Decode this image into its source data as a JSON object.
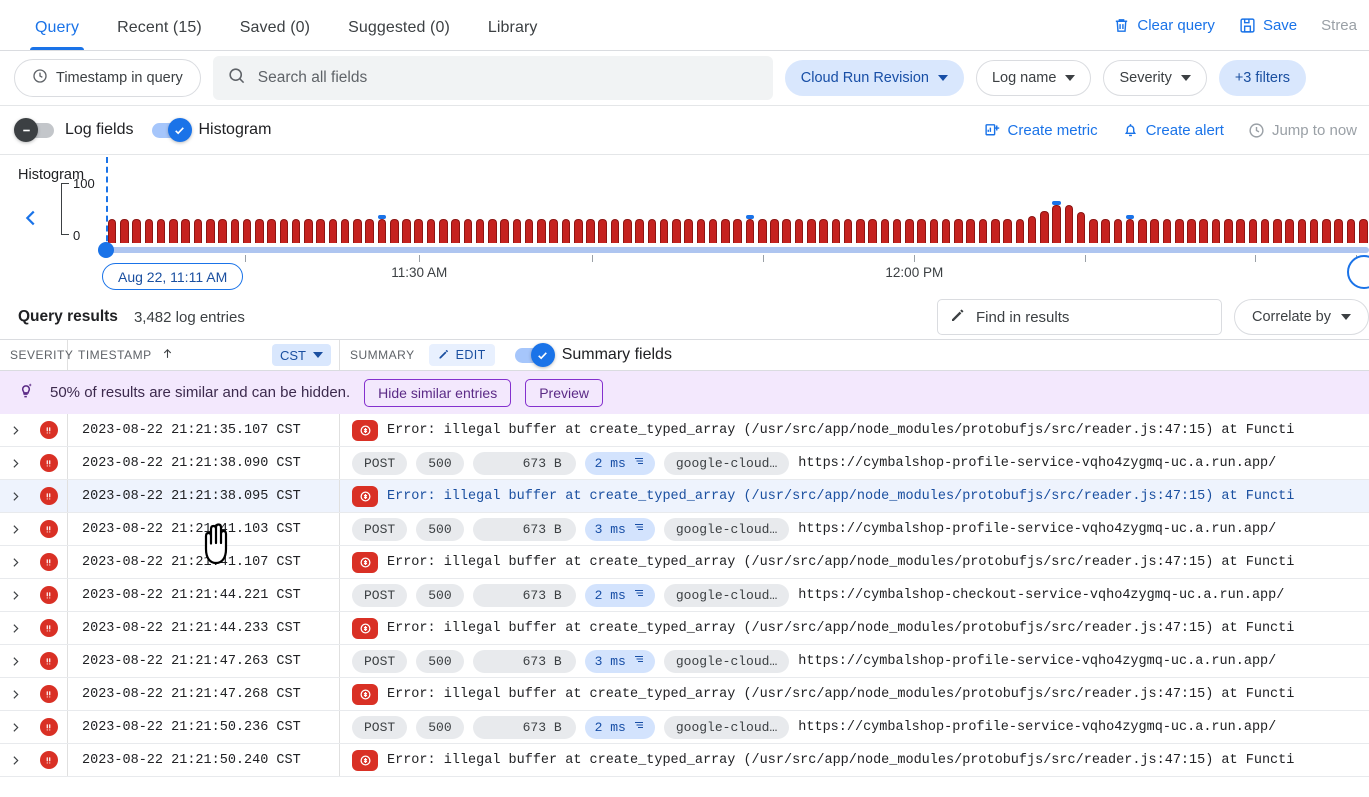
{
  "tabs": [
    {
      "label": "Query",
      "active": true
    },
    {
      "label": "Recent (15)",
      "active": false
    },
    {
      "label": "Saved (0)",
      "active": false
    },
    {
      "label": "Suggested (0)",
      "active": false
    },
    {
      "label": "Library",
      "active": false
    }
  ],
  "top_actions": [
    {
      "label": "Clear query",
      "icon": "trash-icon",
      "disabled": false
    },
    {
      "label": "Save",
      "icon": "save-icon",
      "disabled": false
    },
    {
      "label": "Strea",
      "icon": "none",
      "disabled": true
    }
  ],
  "filters": {
    "timestamp_chip": "Timestamp in query",
    "search_placeholder": "Search all fields",
    "search_value": "",
    "chips": [
      {
        "label": "Cloud Run Revision",
        "selected": true
      },
      {
        "label": "Log name",
        "selected": false
      },
      {
        "label": "Severity",
        "selected": false
      }
    ],
    "more_filters": "+3 filters"
  },
  "toggles": {
    "log_fields": {
      "label": "Log fields",
      "on": false
    },
    "histogram": {
      "label": "Histogram",
      "on": true
    }
  },
  "toolbar_actions": [
    {
      "label": "Create metric",
      "icon": "chart-plus-icon",
      "disabled": false
    },
    {
      "label": "Create alert",
      "icon": "bell-plus-icon",
      "disabled": false
    },
    {
      "label": "Jump to now",
      "icon": "clock-icon",
      "disabled": true
    }
  ],
  "histogram": {
    "title": "Histogram",
    "selection_label": "Aug 22, 11:11 AM",
    "chart_data": {
      "type": "bar",
      "title": "Histogram",
      "xlabel": "",
      "ylabel": "",
      "ylim": [
        0,
        100
      ],
      "ytick_labels": [
        "0",
        "100"
      ],
      "xtick_labels": [
        "11:30 AM",
        "12:00 PM"
      ],
      "xtick_positions_pct": [
        24.8,
        64.0
      ],
      "grid": false,
      "legend": "none",
      "bar_color": "#c5221f",
      "cap_color": "#1a73e8",
      "values": [
        38,
        38,
        38,
        38,
        38,
        38,
        38,
        38,
        38,
        38,
        38,
        38,
        38,
        38,
        38,
        38,
        38,
        38,
        38,
        38,
        38,
        38,
        38,
        38,
        38,
        38,
        38,
        38,
        38,
        38,
        38,
        38,
        38,
        38,
        38,
        38,
        38,
        38,
        38,
        38,
        38,
        38,
        38,
        38,
        38,
        38,
        38,
        38,
        38,
        38,
        38,
        38,
        38,
        38,
        38,
        38,
        38,
        38,
        38,
        38,
        38,
        38,
        38,
        38,
        38,
        38,
        38,
        38,
        38,
        38,
        38,
        38,
        38,
        38,
        38,
        44,
        52,
        62,
        62,
        50,
        38,
        38,
        38,
        38,
        38,
        38,
        38,
        38,
        38,
        38,
        38,
        38,
        38,
        38,
        38,
        38,
        38,
        38,
        38,
        38,
        38,
        38,
        38
      ],
      "capped_indices": [
        22,
        52,
        77,
        83
      ],
      "n_bars": 109
    }
  },
  "results": {
    "title": "Query results",
    "count": "3,482 log entries",
    "find_placeholder": "Find in results",
    "correlate": "Correlate by",
    "columns": {
      "severity": "SEVERITY",
      "timestamp": "TIMESTAMP",
      "timezone": "CST",
      "summary": "SUMMARY",
      "edit": "EDIT",
      "summary_fields": "Summary fields",
      "summary_fields_on": true
    }
  },
  "banner": {
    "text": "50% of results are similar and can be hidden.",
    "hide_button": "Hide similar entries",
    "preview_button": "Preview"
  },
  "log_rows": [
    {
      "type": "error",
      "timestamp": "2023-08-22 21:21:35.107 CST",
      "severity": "ERROR",
      "message": "Error: illegal buffer at create_typed_array (/usr/src/app/node_modules/protobufjs/src/reader.js:47:15) at Functi",
      "highlighted": false
    },
    {
      "type": "request",
      "timestamp": "2023-08-22 21:21:38.090 CST",
      "severity": "ERROR",
      "method": "POST",
      "status": "500",
      "size": "673 B",
      "latency": "2 ms",
      "service": "google-cloud…",
      "url": "https://cymbalshop-profile-service-vqho4zygmq-uc.a.run.app/",
      "highlighted": false
    },
    {
      "type": "error",
      "timestamp": "2023-08-22 21:21:38.095 CST",
      "severity": "ERROR",
      "message": "Error: illegal buffer at create_typed_array (/usr/src/app/node_modules/protobufjs/src/reader.js:47:15) at Functi",
      "highlighted": true
    },
    {
      "type": "request",
      "timestamp": "2023-08-22 21:21:41.103 CST",
      "severity": "ERROR",
      "method": "POST",
      "status": "500",
      "size": "673 B",
      "latency": "3 ms",
      "service": "google-cloud…",
      "url": "https://cymbalshop-profile-service-vqho4zygmq-uc.a.run.app/",
      "highlighted": false
    },
    {
      "type": "error",
      "timestamp": "2023-08-22 21:21:41.107 CST",
      "severity": "ERROR",
      "message": "Error: illegal buffer at create_typed_array (/usr/src/app/node_modules/protobufjs/src/reader.js:47:15) at Functi",
      "highlighted": false
    },
    {
      "type": "request",
      "timestamp": "2023-08-22 21:21:44.221 CST",
      "severity": "ERROR",
      "method": "POST",
      "status": "500",
      "size": "673 B",
      "latency": "2 ms",
      "service": "google-cloud…",
      "url": "https://cymbalshop-checkout-service-vqho4zygmq-uc.a.run.app/",
      "highlighted": false
    },
    {
      "type": "error",
      "timestamp": "2023-08-22 21:21:44.233 CST",
      "severity": "ERROR",
      "message": "Error: illegal buffer at create_typed_array (/usr/src/app/node_modules/protobufjs/src/reader.js:47:15) at Functi",
      "highlighted": false
    },
    {
      "type": "request",
      "timestamp": "2023-08-22 21:21:47.263 CST",
      "severity": "ERROR",
      "method": "POST",
      "status": "500",
      "size": "673 B",
      "latency": "3 ms",
      "service": "google-cloud…",
      "url": "https://cymbalshop-profile-service-vqho4zygmq-uc.a.run.app/",
      "highlighted": false
    },
    {
      "type": "error",
      "timestamp": "2023-08-22 21:21:47.268 CST",
      "severity": "ERROR",
      "message": "Error: illegal buffer at create_typed_array (/usr/src/app/node_modules/protobufjs/src/reader.js:47:15) at Functi",
      "highlighted": false
    },
    {
      "type": "request",
      "timestamp": "2023-08-22 21:21:50.236 CST",
      "severity": "ERROR",
      "method": "POST",
      "status": "500",
      "size": "673 B",
      "latency": "2 ms",
      "service": "google-cloud…",
      "url": "https://cymbalshop-profile-service-vqho4zygmq-uc.a.run.app/",
      "highlighted": false
    },
    {
      "type": "error",
      "timestamp": "2023-08-22 21:21:50.240 CST",
      "severity": "ERROR",
      "message": "Error: illegal buffer at create_typed_array (/usr/src/app/node_modules/protobufjs/src/reader.js:47:15) at Functi",
      "highlighted": false
    }
  ],
  "colors": {
    "accent": "#1a73e8",
    "error": "#d93025",
    "bar": "#c5221f",
    "banner": "#f3e8fd"
  }
}
